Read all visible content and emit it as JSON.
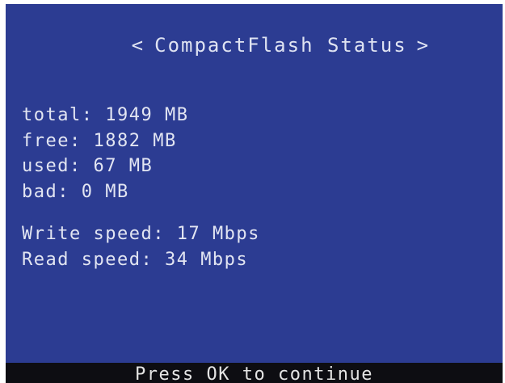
{
  "header": {
    "prev_arrow": "<",
    "title": "CompactFlash Status",
    "next_arrow": ">"
  },
  "stats": [
    {
      "label": "total:",
      "value": "1949 MB"
    },
    {
      "label": "free:",
      "value": "1882 MB"
    },
    {
      "label": "used:",
      "value": "67 MB"
    },
    {
      "label": "bad:",
      "value": "0 MB"
    }
  ],
  "speeds": [
    {
      "label": "Write speed:",
      "value": "17 Mbps"
    },
    {
      "label": "Read speed:",
      "value": "34 Mbps"
    }
  ],
  "footer": {
    "prompt": "Press OK to continue"
  },
  "colors": {
    "screen_background": "#2c3c92",
    "text": "#e2e5f2",
    "footer_background": "#0d0d12"
  }
}
